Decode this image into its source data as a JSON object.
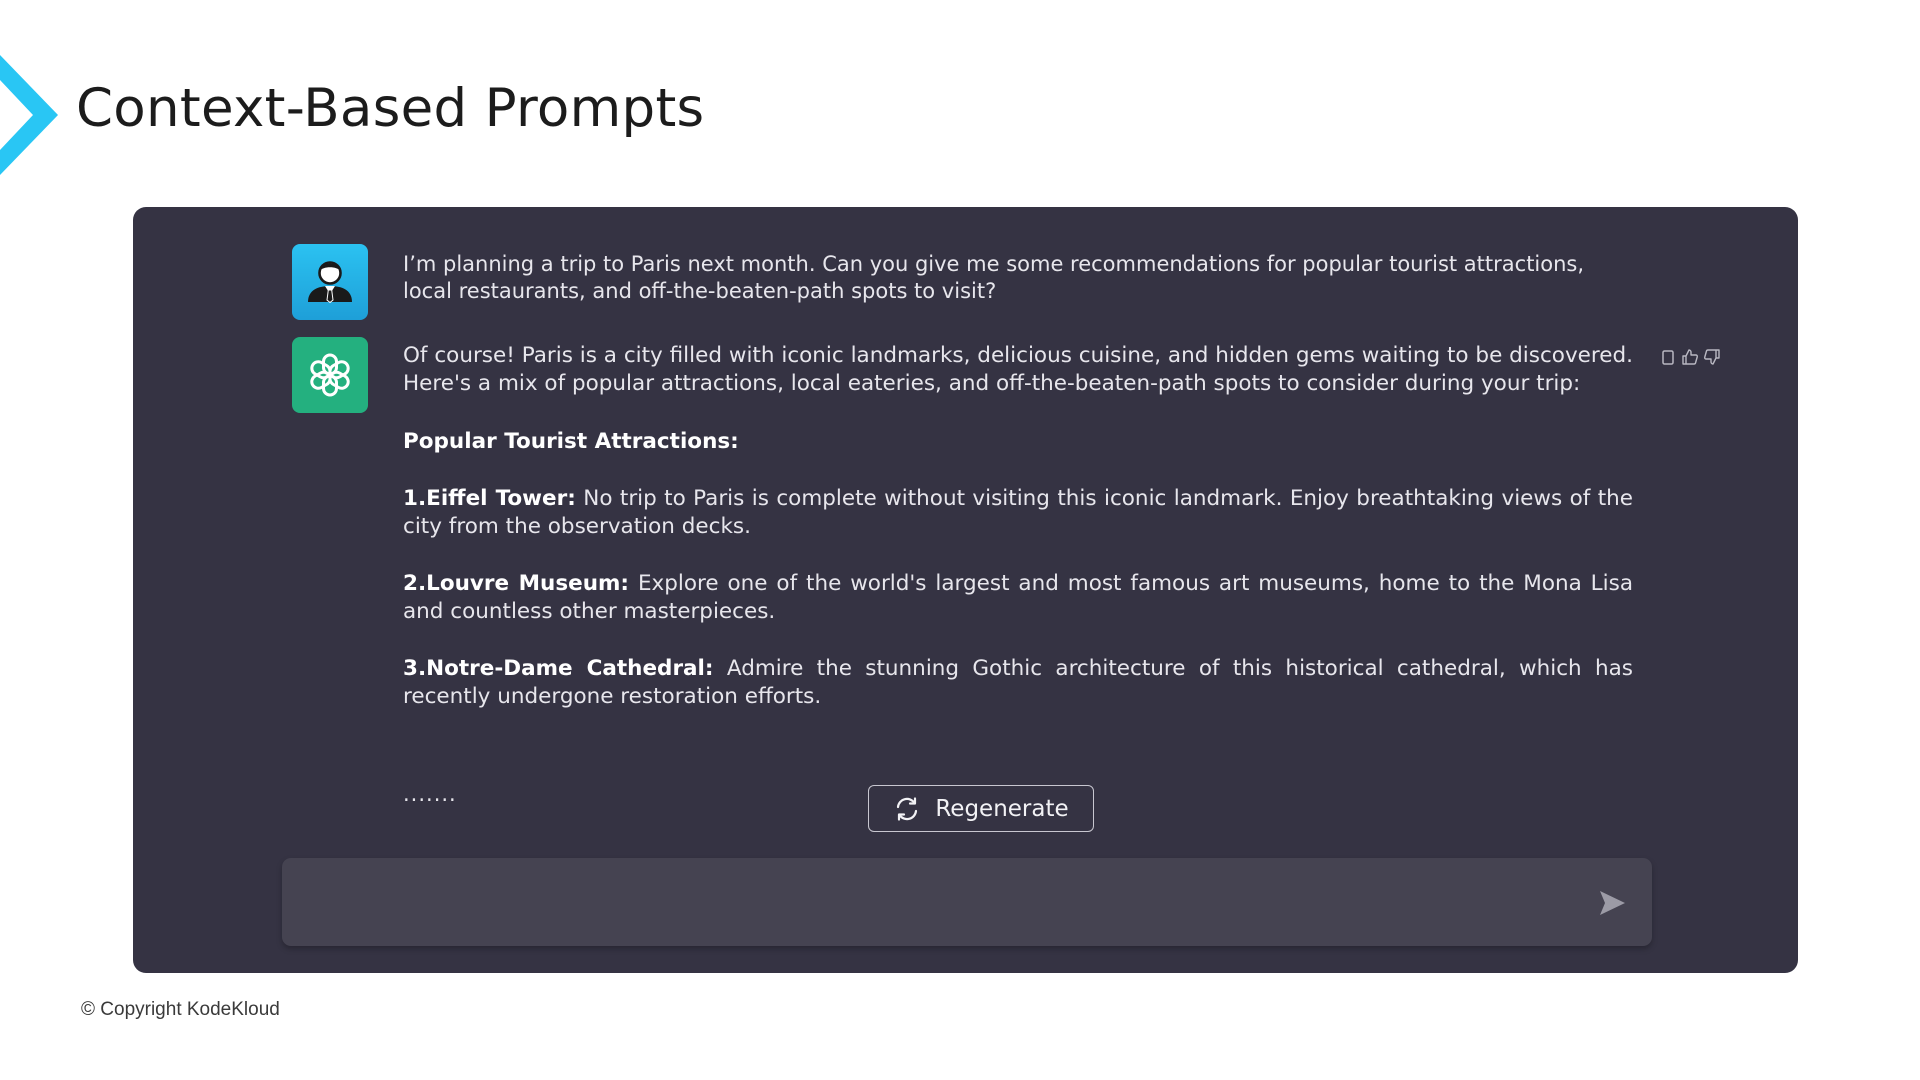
{
  "slide": {
    "title": "Context-Based Prompts",
    "copyright": "© Copyright KodeKloud",
    "accent_color": "#29c6f4"
  },
  "chat": {
    "user_avatar_icon": "user-icon",
    "bot_avatar_icon": "openai-logo-icon",
    "user_message": "I’m planning a trip to Paris next month. Can you give me some recommendations for popular tourist attractions, local restaurants, and off-the-beaten-path spots to visit?",
    "bot_response": {
      "intro": "Of course! Paris is a city filled with iconic landmarks, delicious cuisine, and hidden gems waiting to be discovered. Here's a mix of popular attractions, local eateries, and off-the-beaten-path spots to consider during your trip:",
      "section_heading": "Popular Tourist Attractions:",
      "items": [
        {
          "title": "1.Eiffel Tower:",
          "text": " No trip to Paris is complete without visiting this iconic landmark. Enjoy breathtaking views of the city from the observation decks."
        },
        {
          "title": "2.Louvre Museum:",
          "text": " Explore one of the world's largest and most famous art museums, home to the Mona Lisa and countless other masterpieces."
        },
        {
          "title": "3.Notre-Dame Cathedral:",
          "text": " Admire the stunning Gothic architecture of this historical cathedral, which has recently undergone restoration efforts."
        }
      ],
      "ellipsis": "......."
    },
    "regenerate_label": "Regenerate",
    "input_placeholder": "",
    "panel_color": "#353343",
    "user_avatar_color": "#29c6f4",
    "bot_avatar_color": "#24b07f"
  }
}
